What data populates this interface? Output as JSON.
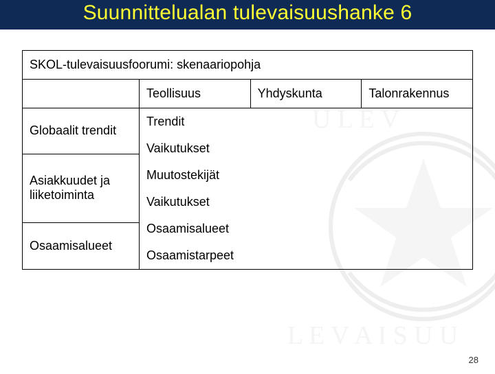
{
  "title": "Suunnittelualan tulevaisuushanke 6",
  "table": {
    "heading": "SKOL-tulevaisuusfoorumi: skenaariopohja",
    "columns": [
      "Teollisuus",
      "Yhdyskunta",
      "Talonrakennus"
    ],
    "rows": {
      "r1_label": "Globaalit trendit",
      "r2_label": "Asiakkuudet ja liiketoiminta",
      "r3_label": "Osaamisalueet"
    },
    "stack": {
      "s1": "Trendit",
      "s2": "Vaikutukset",
      "s3": "Muutostekijät",
      "s4": "Vaikutukset",
      "s5": "Osaamisalueet",
      "s6": "Osaamistarpeet"
    }
  },
  "page_number": "28"
}
